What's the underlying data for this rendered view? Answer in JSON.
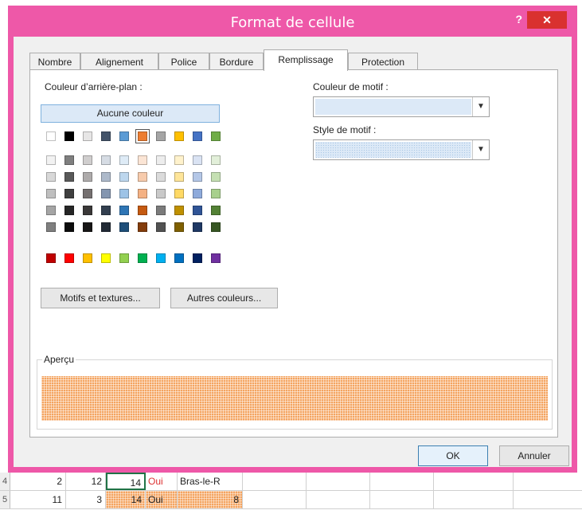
{
  "dialog": {
    "title": "Format de cellule",
    "help": "?",
    "close": "✕"
  },
  "tabs": [
    {
      "label": "Nombre"
    },
    {
      "label": "Alignement"
    },
    {
      "label": "Police"
    },
    {
      "label": "Bordure"
    },
    {
      "label": "Remplissage",
      "active": true
    },
    {
      "label": "Protection"
    }
  ],
  "fill": {
    "background_color_label": "Couleur d’arrière-plan :",
    "no_color_label": "Aucune couleur",
    "pattern_color_label": "Couleur de motif :",
    "pattern_style_label": "Style de motif :",
    "fill_effects_label": "Motifs et textures...",
    "more_colors_label": "Autres couleurs...",
    "preview_label": "Aperçu",
    "selected_color": "#ed7d31",
    "theme_top_row": [
      "#ffffff",
      "#000000",
      "#e7e6e6",
      "#44546a",
      "#5b9bd5",
      "#ed7d31",
      "#a5a5a5",
      "#ffc000",
      "#4472c4",
      "#70ad47"
    ],
    "theme_shades": [
      [
        "#f2f2f2",
        "#7f7f7f",
        "#d0cece",
        "#d6dce4",
        "#deebf6",
        "#fbe5d5",
        "#ededed",
        "#fff2cc",
        "#dae3f3",
        "#e2efd9"
      ],
      [
        "#d8d8d8",
        "#595959",
        "#aeabab",
        "#adb9ca",
        "#bdd7ee",
        "#f7cbac",
        "#dbdbdb",
        "#fee599",
        "#b4c7e7",
        "#c5e0b3"
      ],
      [
        "#bfbfbf",
        "#3f3f3f",
        "#757070",
        "#8496b0",
        "#9dc3e6",
        "#f4b183",
        "#c9c9c9",
        "#ffd965",
        "#8eaadb",
        "#a8d08d"
      ],
      [
        "#a5a5a5",
        "#262626",
        "#3a3838",
        "#323f4f",
        "#2e75b5",
        "#c55a11",
        "#7b7b7b",
        "#bf9000",
        "#2f5496",
        "#538135"
      ],
      [
        "#7f7f7f",
        "#0c0c0c",
        "#171616",
        "#222a35",
        "#1e4e79",
        "#833c0b",
        "#525252",
        "#7f6000",
        "#1f3864",
        "#375623"
      ]
    ],
    "standard_colors": [
      "#c00000",
      "#ff0000",
      "#ffc000",
      "#ffff00",
      "#92d050",
      "#00b050",
      "#00b0f0",
      "#0070c0",
      "#002060",
      "#7030a0"
    ]
  },
  "buttons": {
    "ok": "OK",
    "cancel": "Annuler"
  },
  "sheet": {
    "row4": {
      "num": "4",
      "a": "2",
      "b": "12",
      "c": "14",
      "d": "Oui",
      "e": "Bras-le-R"
    },
    "row5": {
      "num": "5",
      "a": "11",
      "b": "3",
      "c": "14",
      "d": "Oui",
      "e": "8"
    }
  }
}
